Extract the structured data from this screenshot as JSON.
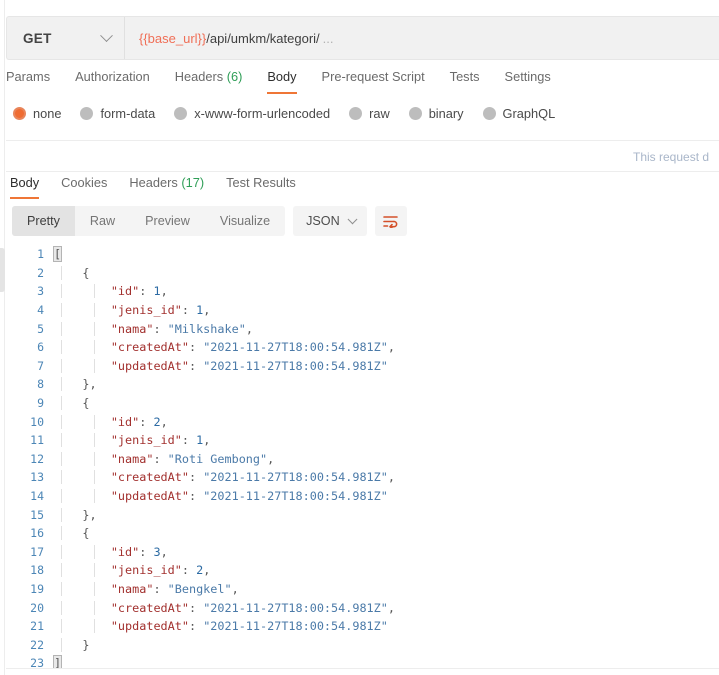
{
  "request": {
    "method": "GET",
    "method_dropdown_icon": "chevron-down-icon",
    "url_variable": "{{base_url}}",
    "url_path": "/api/umkm/kategori/",
    "url_ellipsis": "…",
    "tabs": [
      {
        "label": "Params",
        "active": false
      },
      {
        "label": "Authorization",
        "active": false
      },
      {
        "label": "Headers",
        "count": "(6)",
        "active": false
      },
      {
        "label": "Body",
        "active": true
      },
      {
        "label": "Pre-request Script",
        "active": false
      },
      {
        "label": "Tests",
        "active": false
      },
      {
        "label": "Settings",
        "active": false
      }
    ],
    "body_types": [
      {
        "label": "none",
        "selected": true
      },
      {
        "label": "form-data",
        "selected": false
      },
      {
        "label": "x-www-form-urlencoded",
        "selected": false
      },
      {
        "label": "raw",
        "selected": false
      },
      {
        "label": "binary",
        "selected": false
      },
      {
        "label": "GraphQL",
        "selected": false
      }
    ],
    "note": "This request d"
  },
  "response": {
    "tabs": [
      {
        "label": "Body",
        "active": true
      },
      {
        "label": "Cookies",
        "active": false
      },
      {
        "label": "Headers",
        "count": "(17)",
        "active": false
      },
      {
        "label": "Test Results",
        "active": false
      }
    ],
    "formats": [
      {
        "label": "Pretty",
        "active": true
      },
      {
        "label": "Raw",
        "active": false
      },
      {
        "label": "Preview",
        "active": false
      },
      {
        "label": "Visualize",
        "active": false
      }
    ],
    "language": "JSON",
    "language_dropdown_icon": "chevron-down-icon",
    "wrap_lines_icon": "wrap-lines-icon",
    "wrap_lines_color": "#d4502a"
  },
  "colors": {
    "accent": "#ef7636",
    "radio_selected": "#ef6c32",
    "count_badge": "#2f9e57",
    "url_variable": "#f06f57",
    "json_key": "#a2302e",
    "json_string": "#4b7aa8",
    "json_number": "#2b6aa3",
    "line_number": "#4c86b6"
  },
  "code": {
    "lines": [
      {
        "num": "1",
        "indent": 0,
        "parts": [
          {
            "t": "[",
            "c": "p",
            "hl": true
          }
        ]
      },
      {
        "num": "2",
        "indent": 1,
        "parts": [
          {
            "t": "{",
            "c": "p"
          }
        ]
      },
      {
        "num": "3",
        "indent": 2,
        "parts": [
          {
            "t": "\"id\"",
            "c": "k"
          },
          {
            "t": ": ",
            "c": "p"
          },
          {
            "t": "1",
            "c": "n"
          },
          {
            "t": ",",
            "c": "p"
          }
        ]
      },
      {
        "num": "4",
        "indent": 2,
        "parts": [
          {
            "t": "\"jenis_id\"",
            "c": "k"
          },
          {
            "t": ": ",
            "c": "p"
          },
          {
            "t": "1",
            "c": "n"
          },
          {
            "t": ",",
            "c": "p"
          }
        ]
      },
      {
        "num": "5",
        "indent": 2,
        "parts": [
          {
            "t": "\"nama\"",
            "c": "k"
          },
          {
            "t": ": ",
            "c": "p"
          },
          {
            "t": "\"Milkshake\"",
            "c": "s"
          },
          {
            "t": ",",
            "c": "p"
          }
        ]
      },
      {
        "num": "6",
        "indent": 2,
        "parts": [
          {
            "t": "\"createdAt\"",
            "c": "k"
          },
          {
            "t": ": ",
            "c": "p"
          },
          {
            "t": "\"2021-11-27T18:00:54.981Z\"",
            "c": "s"
          },
          {
            "t": ",",
            "c": "p"
          }
        ]
      },
      {
        "num": "7",
        "indent": 2,
        "parts": [
          {
            "t": "\"updatedAt\"",
            "c": "k"
          },
          {
            "t": ": ",
            "c": "p"
          },
          {
            "t": "\"2021-11-27T18:00:54.981Z\"",
            "c": "s"
          }
        ]
      },
      {
        "num": "8",
        "indent": 1,
        "parts": [
          {
            "t": "},",
            "c": "p"
          }
        ]
      },
      {
        "num": "9",
        "indent": 1,
        "parts": [
          {
            "t": "{",
            "c": "p"
          }
        ]
      },
      {
        "num": "10",
        "indent": 2,
        "parts": [
          {
            "t": "\"id\"",
            "c": "k"
          },
          {
            "t": ": ",
            "c": "p"
          },
          {
            "t": "2",
            "c": "n"
          },
          {
            "t": ",",
            "c": "p"
          }
        ]
      },
      {
        "num": "11",
        "indent": 2,
        "parts": [
          {
            "t": "\"jenis_id\"",
            "c": "k"
          },
          {
            "t": ": ",
            "c": "p"
          },
          {
            "t": "1",
            "c": "n"
          },
          {
            "t": ",",
            "c": "p"
          }
        ]
      },
      {
        "num": "12",
        "indent": 2,
        "parts": [
          {
            "t": "\"nama\"",
            "c": "k"
          },
          {
            "t": ": ",
            "c": "p"
          },
          {
            "t": "\"Roti Gembong\"",
            "c": "s"
          },
          {
            "t": ",",
            "c": "p"
          }
        ]
      },
      {
        "num": "13",
        "indent": 2,
        "parts": [
          {
            "t": "\"createdAt\"",
            "c": "k"
          },
          {
            "t": ": ",
            "c": "p"
          },
          {
            "t": "\"2021-11-27T18:00:54.981Z\"",
            "c": "s"
          },
          {
            "t": ",",
            "c": "p"
          }
        ]
      },
      {
        "num": "14",
        "indent": 2,
        "parts": [
          {
            "t": "\"updatedAt\"",
            "c": "k"
          },
          {
            "t": ": ",
            "c": "p"
          },
          {
            "t": "\"2021-11-27T18:00:54.981Z\"",
            "c": "s"
          }
        ]
      },
      {
        "num": "15",
        "indent": 1,
        "parts": [
          {
            "t": "},",
            "c": "p"
          }
        ]
      },
      {
        "num": "16",
        "indent": 1,
        "parts": [
          {
            "t": "{",
            "c": "p"
          }
        ]
      },
      {
        "num": "17",
        "indent": 2,
        "parts": [
          {
            "t": "\"id\"",
            "c": "k"
          },
          {
            "t": ": ",
            "c": "p"
          },
          {
            "t": "3",
            "c": "n"
          },
          {
            "t": ",",
            "c": "p"
          }
        ]
      },
      {
        "num": "18",
        "indent": 2,
        "parts": [
          {
            "t": "\"jenis_id\"",
            "c": "k"
          },
          {
            "t": ": ",
            "c": "p"
          },
          {
            "t": "2",
            "c": "n"
          },
          {
            "t": ",",
            "c": "p"
          }
        ]
      },
      {
        "num": "19",
        "indent": 2,
        "parts": [
          {
            "t": "\"nama\"",
            "c": "k"
          },
          {
            "t": ": ",
            "c": "p"
          },
          {
            "t": "\"Bengkel\"",
            "c": "s"
          },
          {
            "t": ",",
            "c": "p"
          }
        ]
      },
      {
        "num": "20",
        "indent": 2,
        "parts": [
          {
            "t": "\"createdAt\"",
            "c": "k"
          },
          {
            "t": ": ",
            "c": "p"
          },
          {
            "t": "\"2021-11-27T18:00:54.981Z\"",
            "c": "s"
          },
          {
            "t": ",",
            "c": "p"
          }
        ]
      },
      {
        "num": "21",
        "indent": 2,
        "parts": [
          {
            "t": "\"updatedAt\"",
            "c": "k"
          },
          {
            "t": ": ",
            "c": "p"
          },
          {
            "t": "\"2021-11-27T18:00:54.981Z\"",
            "c": "s"
          }
        ]
      },
      {
        "num": "22",
        "indent": 1,
        "parts": [
          {
            "t": "}",
            "c": "p"
          }
        ]
      },
      {
        "num": "23",
        "indent": 0,
        "parts": [
          {
            "t": "]",
            "c": "p",
            "hl": true
          }
        ]
      }
    ]
  }
}
